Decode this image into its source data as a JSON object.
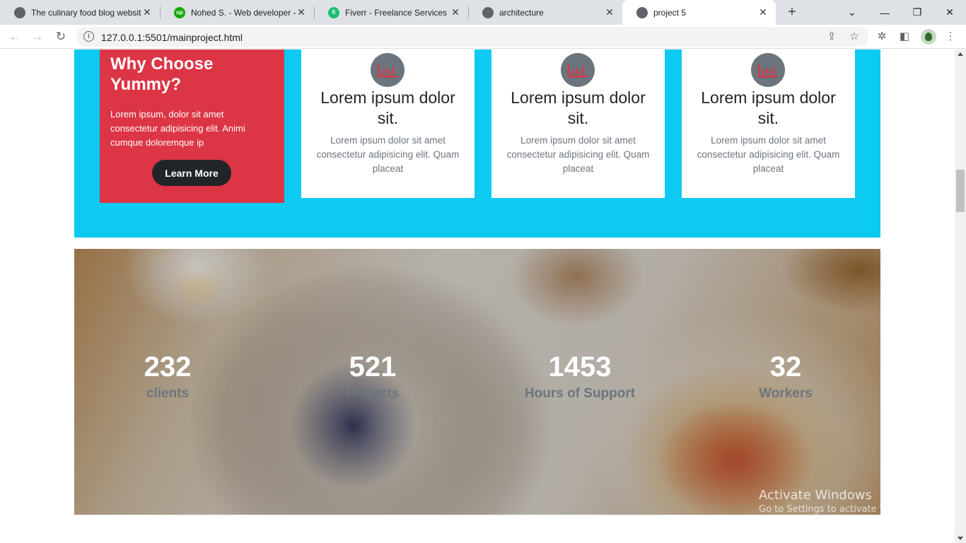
{
  "browser": {
    "tabs": [
      {
        "title": "The culinary food blog website",
        "favicon": "globe-icon",
        "active": false
      },
      {
        "title": "Nohed S. - Web developer - Upwork",
        "favicon": "upwork-icon",
        "active": false
      },
      {
        "title": "Fiverr - Freelance Services Marketplace",
        "favicon": "fiverr-icon",
        "active": false
      },
      {
        "title": "architecture",
        "favicon": "globe-icon",
        "active": false
      },
      {
        "title": "project 5",
        "favicon": "globe-icon",
        "active": true
      }
    ],
    "url": "127.0.0.1:5501/mainproject.html"
  },
  "why": {
    "title": "Why Choose Yummy?",
    "text": "Lorem ipsum, dolor sit amet consectetur adipisicing elit. Animi cumque doloremque ip",
    "button": "Learn More",
    "colors": {
      "section_bg": "#0dcaf0",
      "box_bg": "#dc3545",
      "button_bg": "#212529",
      "icon_bg": "#6c757d"
    }
  },
  "cards": [
    {
      "title": "Lorem ipsum dolor sit.",
      "text": "Lorem ipsum dolor sit amet consectetur adipisicing elit. Quam placeat",
      "icon": "bar-chart-icon"
    },
    {
      "title": "Lorem ipsum dolor sit.",
      "text": "Lorem ipsum dolor sit amet consectetur adipisicing elit. Quam placeat",
      "icon": "bar-chart-icon"
    },
    {
      "title": "Lorem ipsum dolor sit.",
      "text": "Lorem ipsum dolor sit amet consectetur adipisicing elit. Quam placeat",
      "icon": "bar-chart-icon"
    }
  ],
  "stats": [
    {
      "value": "232",
      "label": "clients"
    },
    {
      "value": "521",
      "label": "Projects"
    },
    {
      "value": "1453",
      "label": "Hours of Support"
    },
    {
      "value": "32",
      "label": "Workers"
    }
  ],
  "watermark": {
    "line1": "Activate Windows",
    "line2": "Go to Settings to activate Windows."
  }
}
